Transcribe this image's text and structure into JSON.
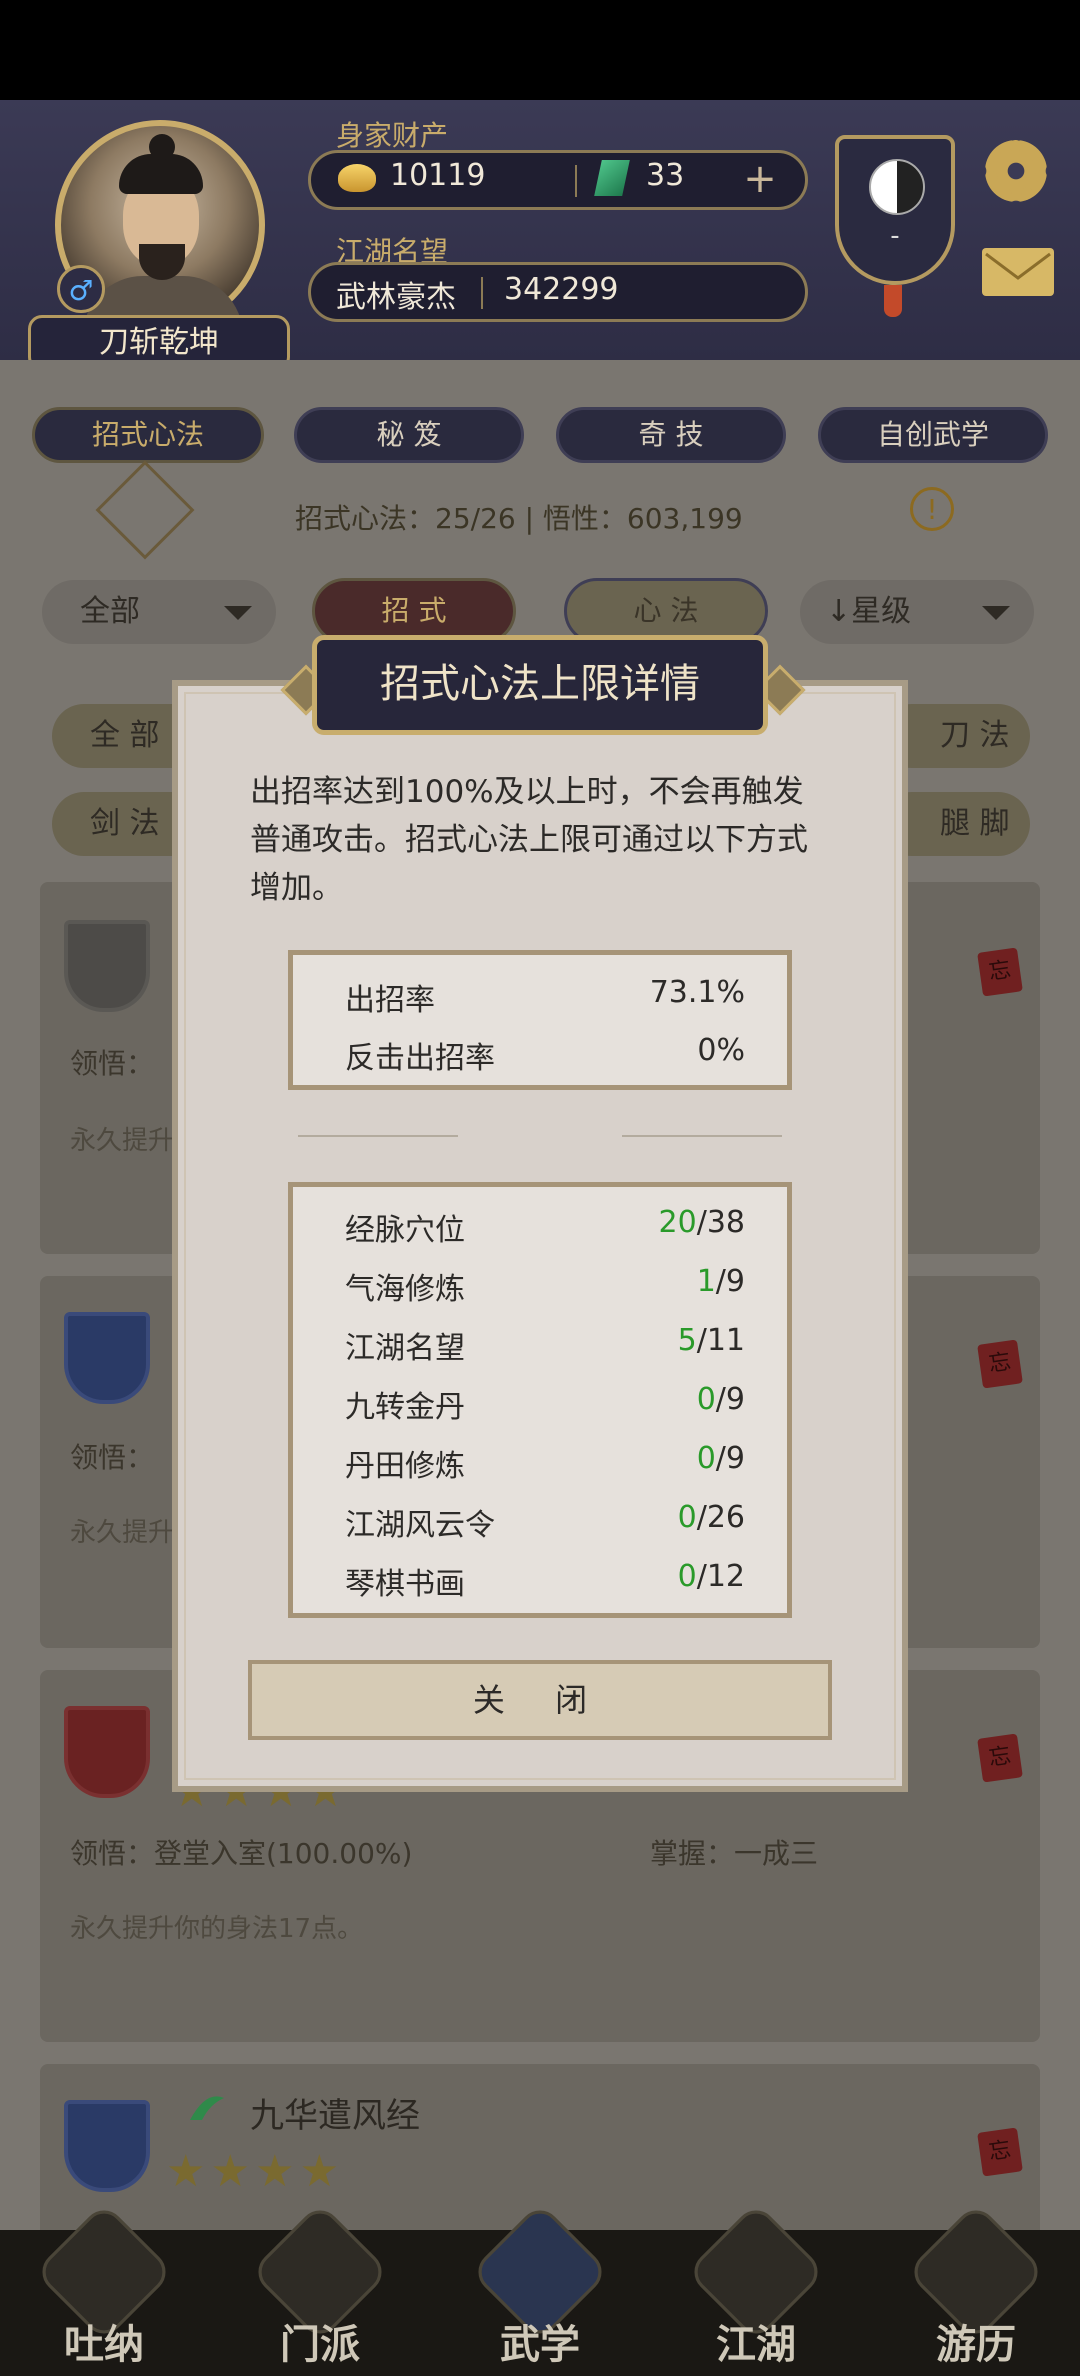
{
  "header": {
    "player_name": "刀斩乾坤",
    "gender_symbol": "♂",
    "wealth_label": "身家财产",
    "gold": "10119",
    "jade": "33",
    "plus": "+",
    "reputation_label": "江湖名望",
    "reputation_title": "武林豪杰",
    "reputation_value": "342299",
    "badge_value": "-"
  },
  "tabs": [
    {
      "label": "招式心法"
    },
    {
      "label": "秘 笈"
    },
    {
      "label": "奇 技"
    },
    {
      "label": "自创武学"
    }
  ],
  "stats": {
    "text": "招式心法：25/26  |  悟性：603,199",
    "info": "!"
  },
  "filters": {
    "all": "全部",
    "zhaoshi": "招 式",
    "xinfa": "心 法",
    "sort": "星级",
    "sort_arrow": "↓",
    "cat_all": "全 部",
    "cat_sword": "剑 法",
    "cat_blade": "刀 法",
    "cat_leg": "腿 脚"
  },
  "cards": [
    {
      "comprehend": "领悟：",
      "desc": "永久提升",
      "seal": "忘"
    },
    {
      "comprehend": "领悟：",
      "desc": "永久提升",
      "seal": "忘"
    },
    {
      "comprehend": "领悟：登堂入室(100.00%)",
      "mastery": "掌握：一成三",
      "desc": "永久提升你的身法17点。",
      "seal": "忘"
    },
    {
      "name": "九华遣风经",
      "seal": "忘"
    }
  ],
  "dialog": {
    "title": "招式心法上限详情",
    "description": "出招率达到100%及以上时，不会再触发普通攻击。招式心法上限可通过以下方式增加。",
    "rates": [
      {
        "label": "出招率",
        "value": "73.1%"
      },
      {
        "label": "反击出招率",
        "value": "0%"
      }
    ],
    "sources": [
      {
        "label": "经脉穴位",
        "current": "20",
        "max": "/38"
      },
      {
        "label": "气海修炼",
        "current": "1",
        "max": "/9"
      },
      {
        "label": "江湖名望",
        "current": "5",
        "max": "/11"
      },
      {
        "label": "九转金丹",
        "current": "0",
        "max": "/9"
      },
      {
        "label": "丹田修炼",
        "current": "0",
        "max": "/9"
      },
      {
        "label": "江湖风云令",
        "current": "0",
        "max": "/26"
      },
      {
        "label": "琴棋书画",
        "current": "0",
        "max": "/12"
      }
    ],
    "close_label": "关 闭"
  },
  "bottom_nav": [
    {
      "label": "吐纳"
    },
    {
      "label": "门派"
    },
    {
      "label": "武学"
    },
    {
      "label": "江湖"
    },
    {
      "label": "游历"
    }
  ],
  "colors": {
    "accent_gold": "#c9ac6b",
    "progress_green": "#2a9a2a",
    "dialog_bg": "#d8d1cb"
  }
}
